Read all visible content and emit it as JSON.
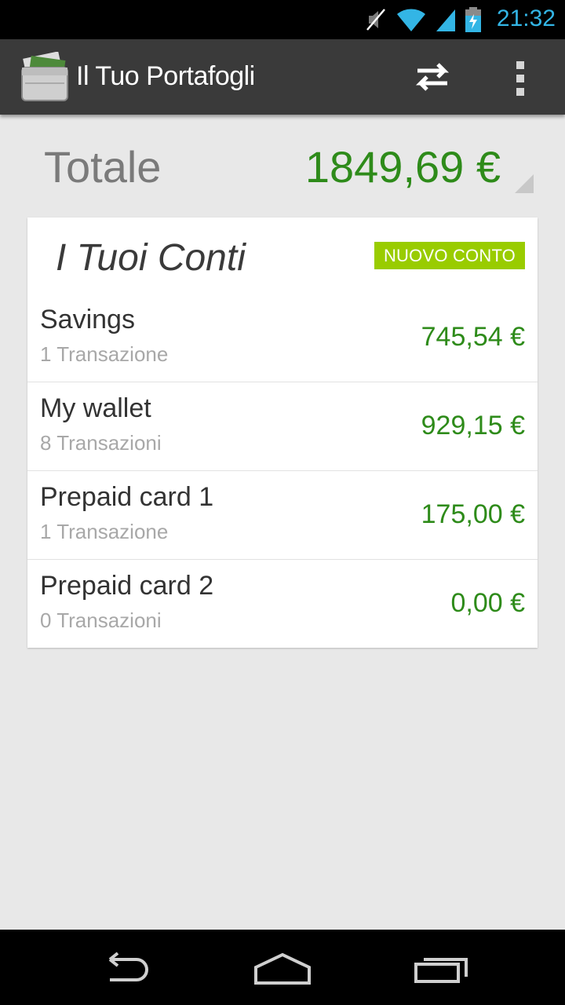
{
  "status_bar": {
    "time": "21:32",
    "icons": [
      "mute-icon",
      "wifi-icon",
      "signal-icon",
      "battery-charging-icon"
    ],
    "accent_color": "#33b5e5"
  },
  "action_bar": {
    "title": "Il Tuo Portafogli",
    "icons": [
      "app-wallet-icon",
      "swap-arrows-icon",
      "overflow-menu-icon"
    ]
  },
  "summary": {
    "label": "Totale",
    "value": "1849,69 €",
    "value_color": "#2e8b1a"
  },
  "accounts_card": {
    "title": "I Tuoi Conti",
    "new_button_label": "NUOVO CONTO",
    "button_color": "#99cc00",
    "items": [
      {
        "name": "Savings",
        "count": "1 Transazione",
        "balance": "745,54 €"
      },
      {
        "name": "My wallet",
        "count": "8 Transazioni",
        "balance": "929,15 €"
      },
      {
        "name": "Prepaid card 1",
        "count": "1 Transazione",
        "balance": "175,00 €"
      },
      {
        "name": "Prepaid card 2",
        "count": "0 Transazioni",
        "balance": "0,00 €"
      }
    ]
  },
  "nav_bar": {
    "icons": [
      "back-icon",
      "home-icon",
      "recent-apps-icon"
    ]
  }
}
